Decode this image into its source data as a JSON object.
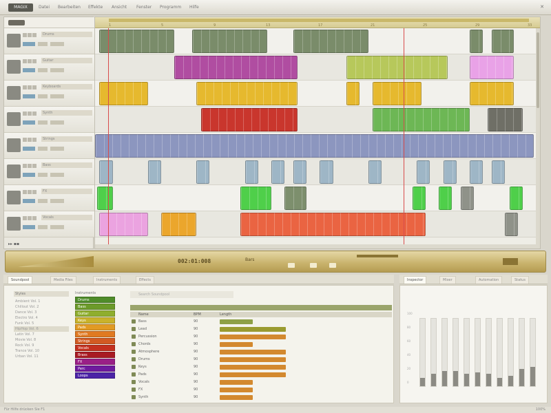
{
  "app": {
    "logo_text": "MAGIX",
    "menu": [
      "Datei",
      "Bearbeiten",
      "Effekte",
      "Ansicht",
      "Fenster",
      "Programm",
      "Hilfe"
    ]
  },
  "colors": {
    "playhead": "#d84b4b",
    "transport": "#c8b26b"
  },
  "tracks": [
    {
      "name": "Drums",
      "thumb_icon": "drums-icon",
      "clips": [
        {
          "s": 0.01,
          "w": 0.17,
          "c": "#7a8c6a"
        },
        {
          "s": 0.22,
          "w": 0.17,
          "c": "#7a8c6a"
        },
        {
          "s": 0.45,
          "w": 0.17,
          "c": "#7a8c6a"
        },
        {
          "s": 0.85,
          "w": 0.03,
          "c": "#7a8c6a"
        },
        {
          "s": 0.9,
          "w": 0.05,
          "c": "#7a8c6a"
        }
      ]
    },
    {
      "name": "Guitar",
      "thumb_icon": "guitar-icon",
      "clips": [
        {
          "s": 0.18,
          "w": 0.28,
          "c": "#b04da1"
        },
        {
          "s": 0.57,
          "w": 0.23,
          "c": "#b7c85b"
        },
        {
          "s": 0.85,
          "w": 0.1,
          "c": "#e9a2e7"
        }
      ]
    },
    {
      "name": "Keyboards",
      "thumb_icon": "keyboard-icon",
      "clips": [
        {
          "s": 0.01,
          "w": 0.11,
          "c": "#e6b92e"
        },
        {
          "s": 0.23,
          "w": 0.23,
          "c": "#e6b92e"
        },
        {
          "s": 0.57,
          "w": 0.03,
          "c": "#e6b92e"
        },
        {
          "s": 0.63,
          "w": 0.11,
          "c": "#e6b92e"
        },
        {
          "s": 0.85,
          "w": 0.1,
          "c": "#e6b92e"
        }
      ]
    },
    {
      "name": "Synth",
      "thumb_icon": "synth-icon",
      "clips": [
        {
          "s": 0.24,
          "w": 0.22,
          "c": "#c9362d"
        },
        {
          "s": 0.63,
          "w": 0.22,
          "c": "#6db755"
        },
        {
          "s": 0.89,
          "w": 0.08,
          "c": "#6f6f66"
        }
      ]
    },
    {
      "name": "Strings",
      "thumb_icon": "strings-icon",
      "clips": [
        {
          "s": 0.0,
          "w": 0.995,
          "c": "#8c96bf"
        }
      ]
    },
    {
      "name": "Bass",
      "thumb_icon": "bass-icon",
      "clips": [
        {
          "s": 0.01,
          "w": 0.03,
          "c": "#9eb6c6"
        },
        {
          "s": 0.12,
          "w": 0.03,
          "c": "#9eb6c6"
        },
        {
          "s": 0.23,
          "w": 0.03,
          "c": "#9eb6c6"
        },
        {
          "s": 0.34,
          "w": 0.03,
          "c": "#9eb6c6"
        },
        {
          "s": 0.4,
          "w": 0.03,
          "c": "#9eb6c6"
        },
        {
          "s": 0.45,
          "w": 0.03,
          "c": "#9eb6c6"
        },
        {
          "s": 0.51,
          "w": 0.03,
          "c": "#9eb6c6"
        },
        {
          "s": 0.62,
          "w": 0.03,
          "c": "#9eb6c6"
        },
        {
          "s": 0.73,
          "w": 0.03,
          "c": "#9eb6c6"
        },
        {
          "s": 0.79,
          "w": 0.03,
          "c": "#9eb6c6"
        },
        {
          "s": 0.85,
          "w": 0.03,
          "c": "#9eb6c6"
        },
        {
          "s": 0.9,
          "w": 0.03,
          "c": "#9eb6c6"
        }
      ]
    },
    {
      "name": "FX",
      "thumb_icon": "fx-icon",
      "clips": [
        {
          "s": 0.005,
          "w": 0.035,
          "c": "#4fcf4a"
        },
        {
          "s": 0.33,
          "w": 0.07,
          "c": "#4fcf4a"
        },
        {
          "s": 0.43,
          "w": 0.05,
          "c": "#7d8f6d"
        },
        {
          "s": 0.72,
          "w": 0.03,
          "c": "#4fcf4a"
        },
        {
          "s": 0.78,
          "w": 0.03,
          "c": "#4fcf4a"
        },
        {
          "s": 0.83,
          "w": 0.03,
          "c": "#8f9289"
        },
        {
          "s": 0.94,
          "w": 0.03,
          "c": "#4fcf4a"
        }
      ]
    },
    {
      "name": "Vocals",
      "thumb_icon": "microphone-icon",
      "clips": [
        {
          "s": 0.01,
          "w": 0.11,
          "c": "#eba3e0"
        },
        {
          "s": 0.15,
          "w": 0.08,
          "c": "#eba62c"
        },
        {
          "s": 0.33,
          "w": 0.42,
          "c": "#ea6442"
        },
        {
          "s": 0.93,
          "w": 0.03,
          "c": "#8f9289"
        }
      ]
    }
  ],
  "ruler": {
    "marks": [
      "1",
      "5",
      "9",
      "13",
      "17",
      "21",
      "25",
      "29",
      "33"
    ]
  },
  "playheads": [
    0.03,
    0.7
  ],
  "transport": {
    "time": "002:01:008",
    "position": "Bars"
  },
  "bottom_left": {
    "tabs": [
      "Soundpool",
      "Media Files",
      "Instruments",
      "Effects"
    ],
    "style_header": "Styles",
    "styles": [
      "Ambient Vol. 1",
      "Chillout Vol. 2",
      "Dance Vol. 3",
      "Electro Vol. 4",
      "Funk Vol. 5",
      "HipHop Vol. 6",
      "Latin Vol. 7",
      "Movie Vol. 8",
      "Rock Vol. 9",
      "Trance Vol. 10",
      "Urban Vol. 11"
    ],
    "palette_header": "Instruments",
    "palette": [
      {
        "name": "Drums",
        "color": "#4f8c2a"
      },
      {
        "name": "Bass",
        "color": "#6c9a2a"
      },
      {
        "name": "Guitar",
        "color": "#8fae2e"
      },
      {
        "name": "Keys",
        "color": "#c9b22b"
      },
      {
        "name": "Pads",
        "color": "#e19a24"
      },
      {
        "name": "Synth",
        "color": "#e07a22"
      },
      {
        "name": "Strings",
        "color": "#d25a22"
      },
      {
        "name": "Vocals",
        "color": "#c4301e"
      },
      {
        "name": "Brass",
        "color": "#a81a23"
      },
      {
        "name": "FX",
        "color": "#9a1f86"
      },
      {
        "name": "Perc",
        "color": "#6f1a9e"
      },
      {
        "name": "Loops",
        "color": "#4b23a6"
      }
    ],
    "search_placeholder": "Search Soundpool",
    "columns": [
      "Name",
      "BPM",
      "Length"
    ],
    "rows": [
      {
        "name": "Bass",
        "bpm": "90",
        "len": 0.16
      },
      {
        "name": "Lead",
        "bpm": "90",
        "len": 0.32
      },
      {
        "name": "Percussion",
        "bpm": "90",
        "len": 0.32
      },
      {
        "name": "Chords",
        "bpm": "90",
        "len": 0.16
      },
      {
        "name": "Atmosphere",
        "bpm": "90",
        "len": 0.32
      },
      {
        "name": "Drums",
        "bpm": "90",
        "len": 0.32
      },
      {
        "name": "Keys",
        "bpm": "90",
        "len": 0.32
      },
      {
        "name": "Pads",
        "bpm": "90",
        "len": 0.32
      },
      {
        "name": "Vocals",
        "bpm": "90",
        "len": 0.16
      },
      {
        "name": "FX",
        "bpm": "90",
        "len": 0.16
      },
      {
        "name": "Synth",
        "bpm": "90",
        "len": 0.16
      }
    ]
  },
  "bottom_right": {
    "tabs": [
      "Inspector",
      "Mixer",
      "Automation",
      "Status"
    ],
    "chart": {
      "levels": [
        0.12,
        0.18,
        0.22,
        0.22,
        0.18,
        0.2,
        0.18,
        0.12,
        0.15,
        0.25,
        0.28
      ],
      "y_ticks": [
        "100",
        "80",
        "60",
        "40",
        "20",
        "0"
      ]
    }
  },
  "status": {
    "left": "Für Hilfe drücken Sie F1",
    "right": "100%"
  }
}
